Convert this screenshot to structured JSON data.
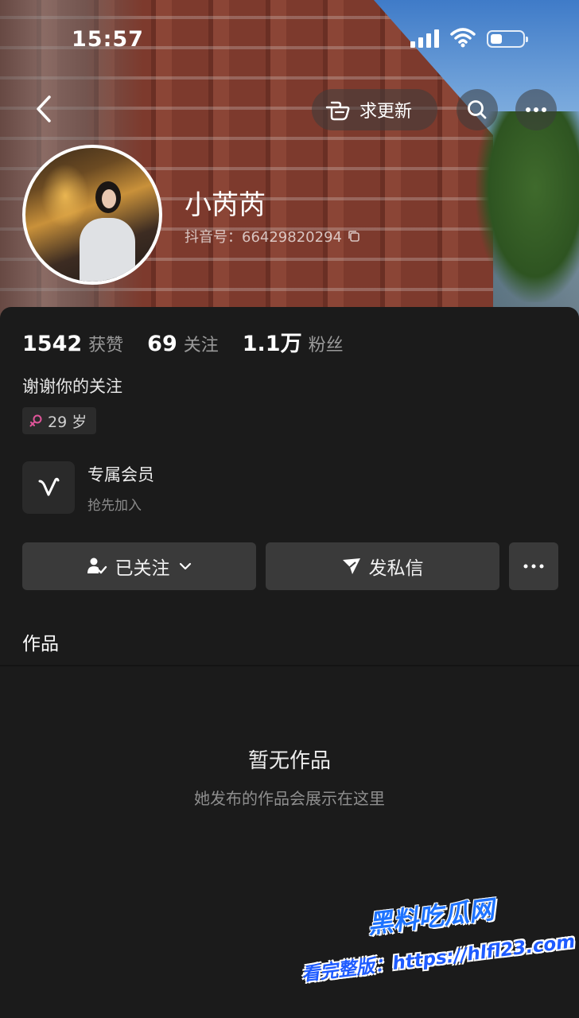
{
  "status_bar": {
    "time": "15:57"
  },
  "header": {
    "update_label": "求更新",
    "nickname": "小芮芮",
    "douyin_id": "抖音号：66429820294"
  },
  "stats": [
    {
      "value": "1542",
      "label": "获赞"
    },
    {
      "value": "69",
      "label": "关注"
    },
    {
      "value": "1.1万",
      "label": "粉丝"
    }
  ],
  "profile": {
    "bio": "谢谢你的关注",
    "age_tag": "29 岁"
  },
  "membership": {
    "title": "专属会员",
    "subtitle": "抢先加入"
  },
  "actions": {
    "follow_label": "已关注",
    "dm_label": "发私信"
  },
  "tabs": {
    "works_label": "作品"
  },
  "empty_state": {
    "title": "暂无作品",
    "subtitle": "她发布的作品会展示在这里"
  },
  "watermark": {
    "logo_text": "黑料吃瓜网",
    "url_text": "看完整版：https://hlfl23.com"
  },
  "colors": {
    "background": "#1b1b1b",
    "button": "#3a3a3a",
    "watermark_blue": "#1e73ff",
    "female_icon": "#e0559a"
  }
}
